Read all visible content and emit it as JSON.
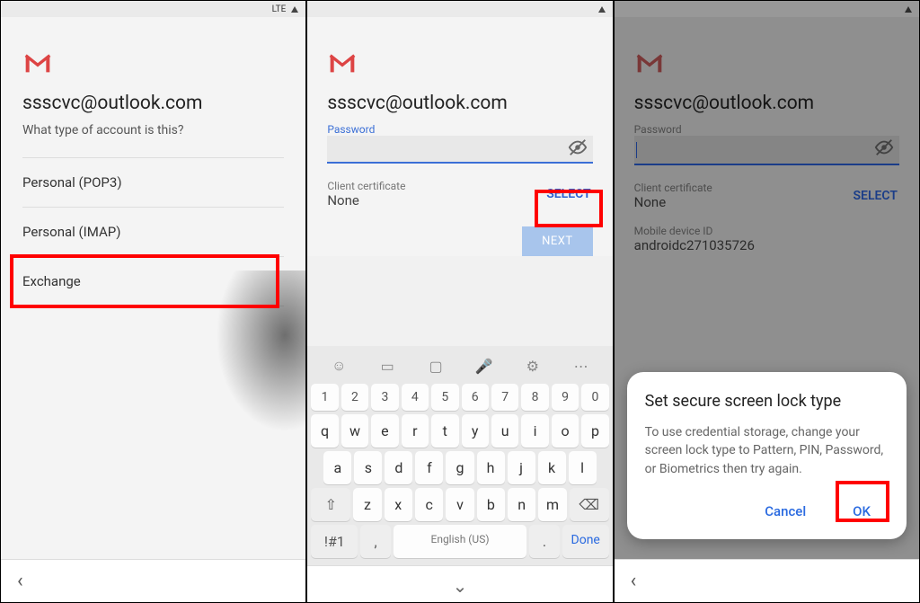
{
  "statusbar": {
    "carrier": "LTE"
  },
  "gmail": {
    "email": "ssscvc@outlook.com"
  },
  "screen1": {
    "subtitle": "What type of account is this?",
    "options": [
      "Personal (POP3)",
      "Personal (IMAP)",
      "Exchange"
    ]
  },
  "screen2": {
    "password_label": "Password",
    "cert_label": "Client certificate",
    "cert_value": "None",
    "select": "SELECT",
    "next": "NEXT",
    "keyboard": {
      "numbers": [
        "1",
        "2",
        "3",
        "4",
        "5",
        "6",
        "7",
        "8",
        "9",
        "0"
      ],
      "row1": [
        "q",
        "w",
        "e",
        "r",
        "t",
        "y",
        "u",
        "i",
        "o",
        "p"
      ],
      "row2": [
        "a",
        "s",
        "d",
        "f",
        "g",
        "h",
        "j",
        "k",
        "l"
      ],
      "row3_shift": "⇧",
      "row3": [
        "z",
        "x",
        "c",
        "v",
        "b",
        "n",
        "m"
      ],
      "row3_bksp": "⌫",
      "sym": "!#1",
      "comma": ",",
      "space": "English (US)",
      "period": ".",
      "done": "Done"
    }
  },
  "screen3": {
    "password_label": "Password",
    "cert_label": "Client certificate",
    "cert_value": "None",
    "select": "SELECT",
    "device_label": "Mobile device ID",
    "device_value": "androidc271035726",
    "dialog": {
      "title": "Set secure screen lock type",
      "body": "To use credential storage, change your screen lock type to Pattern, PIN, Password, or Biometrics then try again.",
      "cancel": "Cancel",
      "ok": "OK"
    }
  }
}
